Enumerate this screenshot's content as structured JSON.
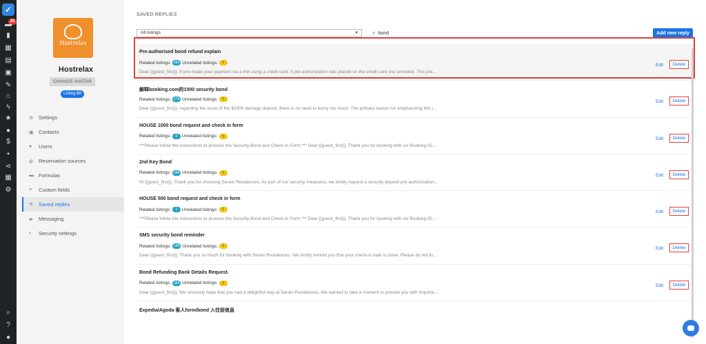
{
  "rail": {
    "badge": "25",
    "icons": [
      "logo-check-icon",
      "messages-icon",
      "stats-icon",
      "calendar-icon",
      "tasks-icon",
      "listings-icon",
      "brush-icon",
      "check-icon",
      "home-icon",
      "bolt-icon",
      "star-icon",
      "team-icon",
      "dollar-icon",
      "briefcase-icon",
      "share-icon",
      "grid-icon",
      "gear-icon",
      "search-icon",
      "help-icon",
      "profile-icon"
    ]
  },
  "profile": {
    "avatar_text": "Hostrelax",
    "name": "Hostrelax",
    "change_avatar": "CHANGE AVATAR",
    "listing": "Listing $8"
  },
  "nav": {
    "items": [
      {
        "label": "Settings",
        "icon": "gear-icon"
      },
      {
        "label": "Contacts",
        "icon": "contacts-icon"
      },
      {
        "label": "Users",
        "icon": "users-icon"
      },
      {
        "label": "Reservation sources",
        "icon": "globe-icon"
      },
      {
        "label": "Formulas",
        "icon": "formula-icon"
      },
      {
        "label": "Custom fields",
        "icon": "list-icon"
      },
      {
        "label": "Saved replies",
        "icon": "reply-icon",
        "active": true
      },
      {
        "label": "Messaging",
        "icon": "chat-icon"
      },
      {
        "label": "Security settings",
        "icon": "shield-icon"
      }
    ]
  },
  "main": {
    "title": "SAVED REPLIES",
    "filter_value": "All listings",
    "search_value": "bond",
    "add_button": "Add new reply",
    "related_label": "Related listings:",
    "unrelated_label": "Unrelated listings:",
    "edit_label": "Edit",
    "delete_label": "Delete",
    "replies": [
      {
        "title": "Pre-authorised bond refund explain",
        "related": "284",
        "unrelated": "0",
        "preview": "Dear {{guest_first}}, If you made your payment via a link using a credit card: A pre-authorization was placed on the credit card you provided. This pre..."
      },
      {
        "title": "解释booking.com的1000 security bond",
        "related": "178",
        "unrelated": "0",
        "preview": "Dear {{guest_first}}, regarding the issue of the $1000 damage deposit, there is no need to worry too much. The primary reason for emphasizing this i..."
      },
      {
        "title": "HOUSE 1000 bond request and check in form",
        "related": "0",
        "unrelated": "0",
        "preview": "***Please follow the instructions to process the Security Bond and Check-in Form.*** Dear {{guest_first}}, Thank you for booking with us! Booking ID:..."
      },
      {
        "title": "2nd Key Bond",
        "related": "246",
        "unrelated": "0",
        "preview": "Hi {{guest_first}}, Thank you for choosing Serain Residences. As part of our security measures, we kindly request a security deposit pre-authorization..."
      },
      {
        "title": "HOUSE 500 bond request and check in form",
        "related": "1",
        "unrelated": "0",
        "preview": "***Please follow the instructions to process the Security Bond and Check-in Form.*** Dear {{guest_first}}, Thank you for booking with us! Booking ID:..."
      },
      {
        "title": "SMS security bond reminder",
        "related": "140",
        "unrelated": "0",
        "preview": "Dear {{guest_first}}, Thank you so much for booking with Serain Residences. We kindly remind you that your check-in date is close. Please do not fo..."
      },
      {
        "title": "Bond Refunding Bank Details Request.",
        "related": "284",
        "unrelated": "0",
        "preview": "Dear {{guest_first}}, We sincerely hope that you had a delightful stay at Serain Residences. We wanted to take a moment to provide you with Importa..."
      },
      {
        "title": "Expedia/Agoda 客人form/bond 入住前信息",
        "related": "",
        "unrelated": "",
        "preview": ""
      }
    ]
  }
}
